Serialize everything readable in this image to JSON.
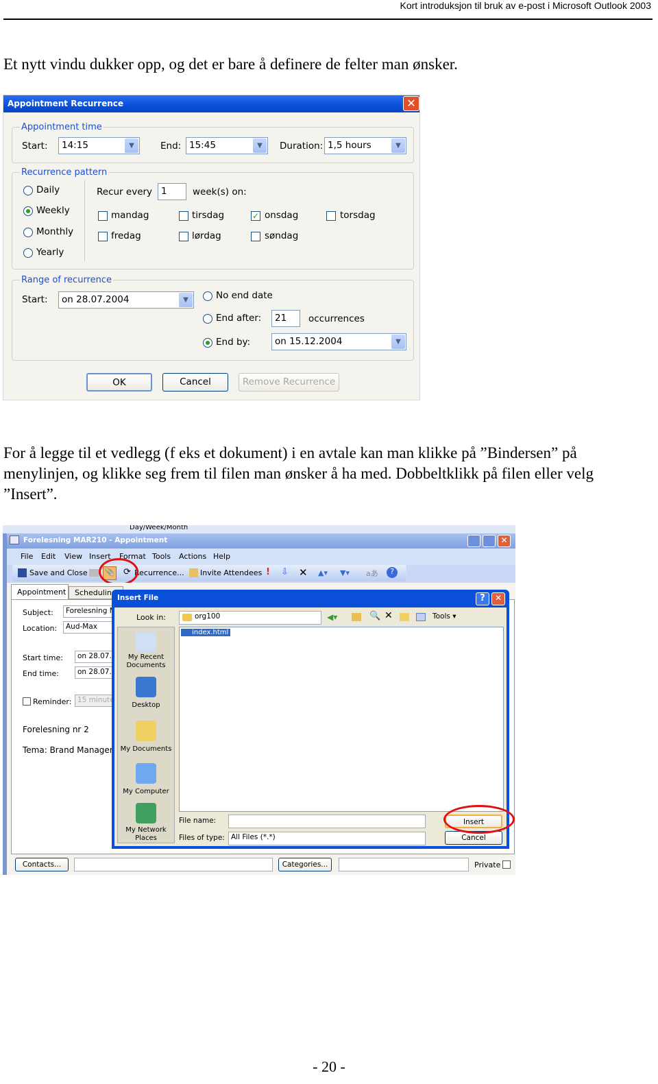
{
  "header": "Kort introduksjon til bruk av e-post i Microsoft Outlook 2003",
  "paragraph1": "Et nytt vindu dukker opp, og det er bare å definere de felter man ønsker.",
  "recurrence_dialog": {
    "title": "Appointment Recurrence",
    "appointment_time": {
      "legend": "Appointment time",
      "start_label": "Start:",
      "start_value": "14:15",
      "end_label": "End:",
      "end_value": "15:45",
      "duration_label": "Duration:",
      "duration_value": "1,5 hours"
    },
    "pattern": {
      "legend": "Recurrence pattern",
      "options": [
        "Daily",
        "Weekly",
        "Monthly",
        "Yearly"
      ],
      "selected": "Weekly",
      "recur_every_label": "Recur every",
      "recur_every_value": "1",
      "weeks_on_label": "week(s) on:",
      "days": [
        {
          "label": "mandag",
          "checked": false
        },
        {
          "label": "tirsdag",
          "checked": false
        },
        {
          "label": "onsdag",
          "checked": true
        },
        {
          "label": "torsdag",
          "checked": false
        },
        {
          "label": "fredag",
          "checked": false
        },
        {
          "label": "lørdag",
          "checked": false
        },
        {
          "label": "søndag",
          "checked": false
        }
      ]
    },
    "range": {
      "legend": "Range of recurrence",
      "start_label": "Start:",
      "start_value": "on 28.07.2004",
      "no_end": "No end date",
      "end_after": "End after:",
      "occurrences_value": "21",
      "occurrences_label": "occurrences",
      "end_by": "End by:",
      "end_by_value": "on 15.12.2004",
      "selected": "End by"
    },
    "buttons": {
      "ok": "OK",
      "cancel": "Cancel",
      "remove": "Remove Recurrence"
    }
  },
  "paragraph2": "For å legge til et vedlegg (f eks et dokument) i en avtale kan man klikke på ”Bindersen” på menylinjen, og klikke seg frem til filen man ønsker å ha med. Dobbeltklikk på filen eller velg ”Insert”.",
  "outlook": {
    "background_toolbar": "Day/Week/Month",
    "window_title": "Forelesning MAR210 - Appointment",
    "menu": [
      "File",
      "Edit",
      "View",
      "Insert",
      "Format",
      "Tools",
      "Actions",
      "Help"
    ],
    "toolbar": {
      "save_close": "Save and Close",
      "recurrence": "Recurrence...",
      "invite": "Invite Attendees"
    },
    "tabs": [
      "Appointment",
      "Scheduling"
    ],
    "form": {
      "subject_label": "Subject:",
      "subject_value": "Forelesning MA",
      "location_label": "Location:",
      "location_value": "Aud-Max",
      "start_label": "Start time:",
      "start_value": "on 28.07.2",
      "end_label": "End time:",
      "end_value": "on 28.07.2",
      "reminder_label": "Reminder:",
      "reminder_value": "15 minutes",
      "notes_line1": "Forelesning nr 2",
      "notes_line2": "Tema: Brand Managem"
    },
    "footer": {
      "contacts": "Contacts...",
      "categories": "Categories...",
      "private": "Private"
    },
    "highlight_color": "#e01010"
  },
  "insert_file": {
    "title": "Insert File",
    "look_in_label": "Look in:",
    "look_in_value": "org100",
    "tools": "Tools",
    "places": [
      "My Recent Documents",
      "Desktop",
      "My Documents",
      "My Computer",
      "My Network Places"
    ],
    "files": [
      "index.html"
    ],
    "file_name_label": "File name:",
    "file_name_value": "",
    "file_type_label": "Files of type:",
    "file_type_value": "All Files (*.*)",
    "insert": "Insert",
    "cancel": "Cancel"
  },
  "page_number": "- 20 -"
}
